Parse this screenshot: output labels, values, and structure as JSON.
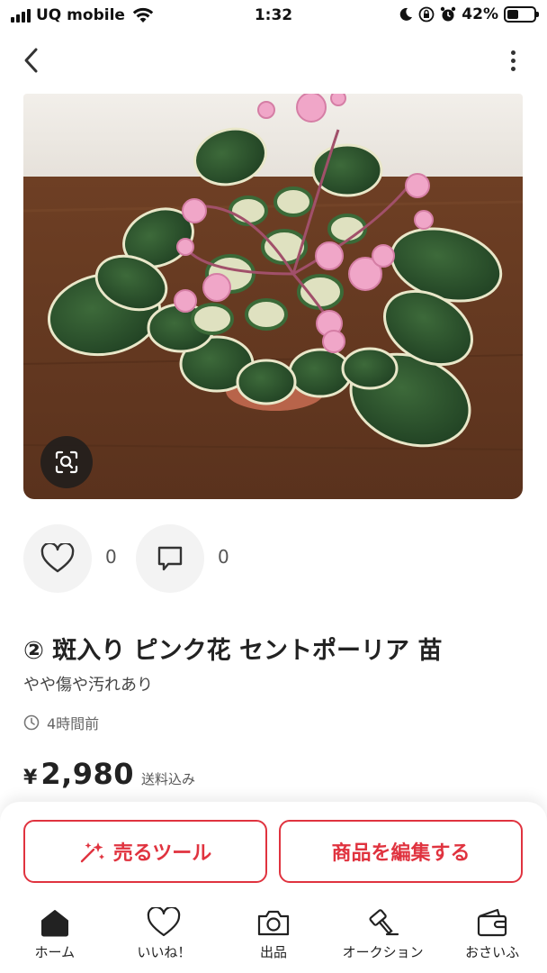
{
  "status_bar": {
    "carrier": "UQ mobile",
    "time": "1:32",
    "battery": "42%",
    "battery_level": 0.42
  },
  "product": {
    "title": "② 斑入り ピンク花 セントポーリア 苗",
    "condition": "やや傷や汚れあり",
    "posted": "4時間前",
    "currency": "¥",
    "price": "2,980",
    "shipping": "送料込み"
  },
  "actions": {
    "likes": "0",
    "comments": "0"
  },
  "buttons": {
    "sell_tool": "売るツール",
    "edit_item": "商品を編集する"
  },
  "tabs": [
    {
      "label": "ホーム",
      "icon": "home-icon"
    },
    {
      "label": "いいね！",
      "icon": "heart-icon"
    },
    {
      "label": "出品",
      "icon": "camera-icon"
    },
    {
      "label": "オークション",
      "icon": "gavel-icon"
    },
    {
      "label": "おさいふ",
      "icon": "wallet-icon"
    }
  ],
  "colors": {
    "accent": "#e0333f"
  }
}
